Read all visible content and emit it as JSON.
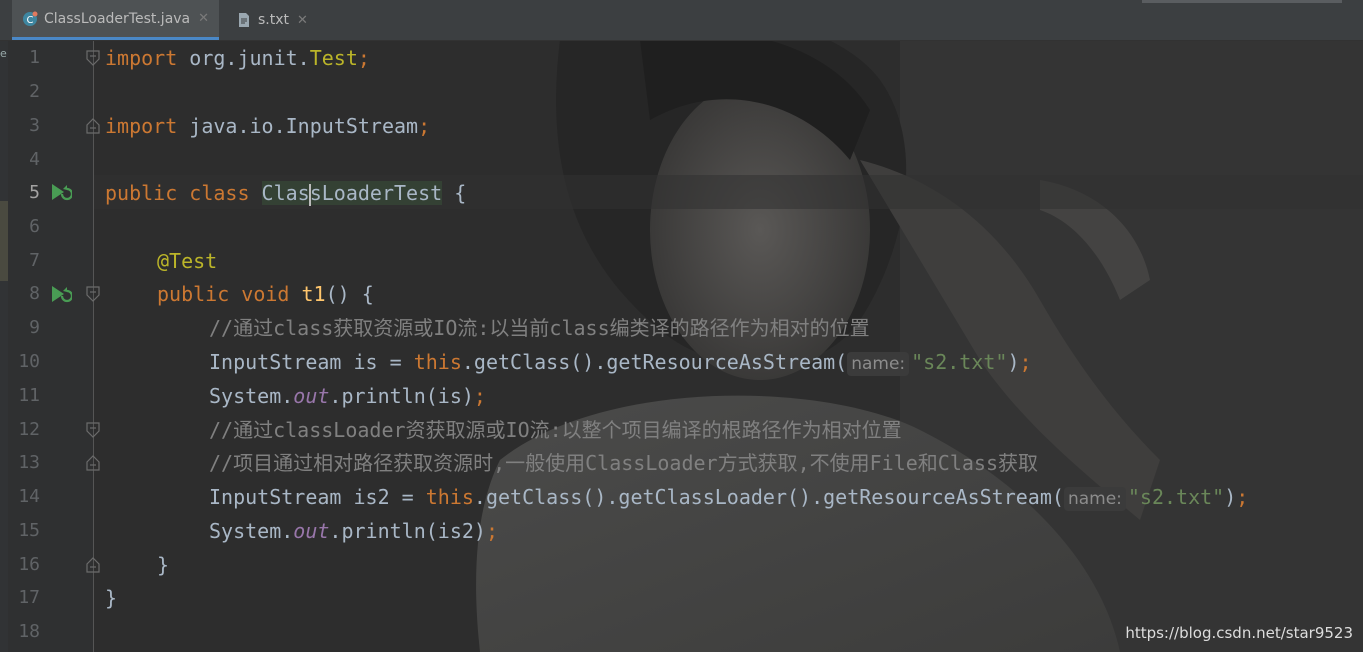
{
  "tabs": [
    {
      "label": "ClassLoaderTest.java",
      "icon": "java-class-icon",
      "active": true
    },
    {
      "label": "s.txt",
      "icon": "text-file-icon",
      "active": false
    }
  ],
  "lines": [
    {
      "n": "1"
    },
    {
      "n": "2"
    },
    {
      "n": "3"
    },
    {
      "n": "4"
    },
    {
      "n": "5"
    },
    {
      "n": "6"
    },
    {
      "n": "7"
    },
    {
      "n": "8"
    },
    {
      "n": "9"
    },
    {
      "n": "10"
    },
    {
      "n": "11"
    },
    {
      "n": "12"
    },
    {
      "n": "13"
    },
    {
      "n": "14"
    },
    {
      "n": "15"
    },
    {
      "n": "16"
    },
    {
      "n": "17"
    },
    {
      "n": "18"
    }
  ],
  "code": {
    "l1": {
      "kw": "import",
      "pkg": " org.junit.",
      "cls": "Test",
      "semi": ";"
    },
    "l3": {
      "kw": "import",
      "pkg": " java.io.InputStream",
      "semi": ";"
    },
    "l5": {
      "kw1": "public",
      "kw2": " class ",
      "name_a": "Clas",
      "name_b": "sLoaderTest",
      "rest": " {"
    },
    "l7": {
      "ann": "@Test"
    },
    "l8": {
      "kw1": "public",
      "kw2": " void ",
      "fn": "t1",
      "rest": "() {"
    },
    "l9": {
      "cmt": "//通过class获取资源或IO流:以当前class编类译的路径作为相对的位置"
    },
    "l10": {
      "a": "InputStream is = ",
      "kw": "this",
      "b": ".getClass().getResourceAsStream(",
      "hint": "name:",
      "str": "\"s2.txt\"",
      "c": ")",
      "semi": ";"
    },
    "l11": {
      "a": "System.",
      "fld": "out",
      "b": ".println(is)",
      "semi": ";"
    },
    "l12": {
      "cmt": "//通过classLoader资获取源或IO流:以整个项目编译的根路径作为相对位置"
    },
    "l13": {
      "cmt": "//项目通过相对路径获取资源时,一般使用ClassLoader方式获取,不使用File和Class获取"
    },
    "l14": {
      "a": "InputStream is2 = ",
      "kw": "this",
      "b": ".getClass().getClassLoader().getResourceAsStream(",
      "hint": "name:",
      "str": "\"s2.txt\"",
      "c": ")",
      "semi": ";"
    },
    "l15": {
      "a": "System.",
      "fld": "out",
      "b": ".println(is2)",
      "semi": ";"
    },
    "l16": {
      "rest": "}"
    },
    "l17": {
      "rest": "}"
    }
  },
  "current_line": "5",
  "watermark": "https://blog.csdn.net/star9523",
  "colors": {
    "keyword": "#cc7832",
    "annotation": "#bbb529",
    "method": "#ffc66d",
    "string": "#6a8759",
    "comment": "#808080",
    "field": "#9876aa",
    "text": "#a9b7c6"
  }
}
